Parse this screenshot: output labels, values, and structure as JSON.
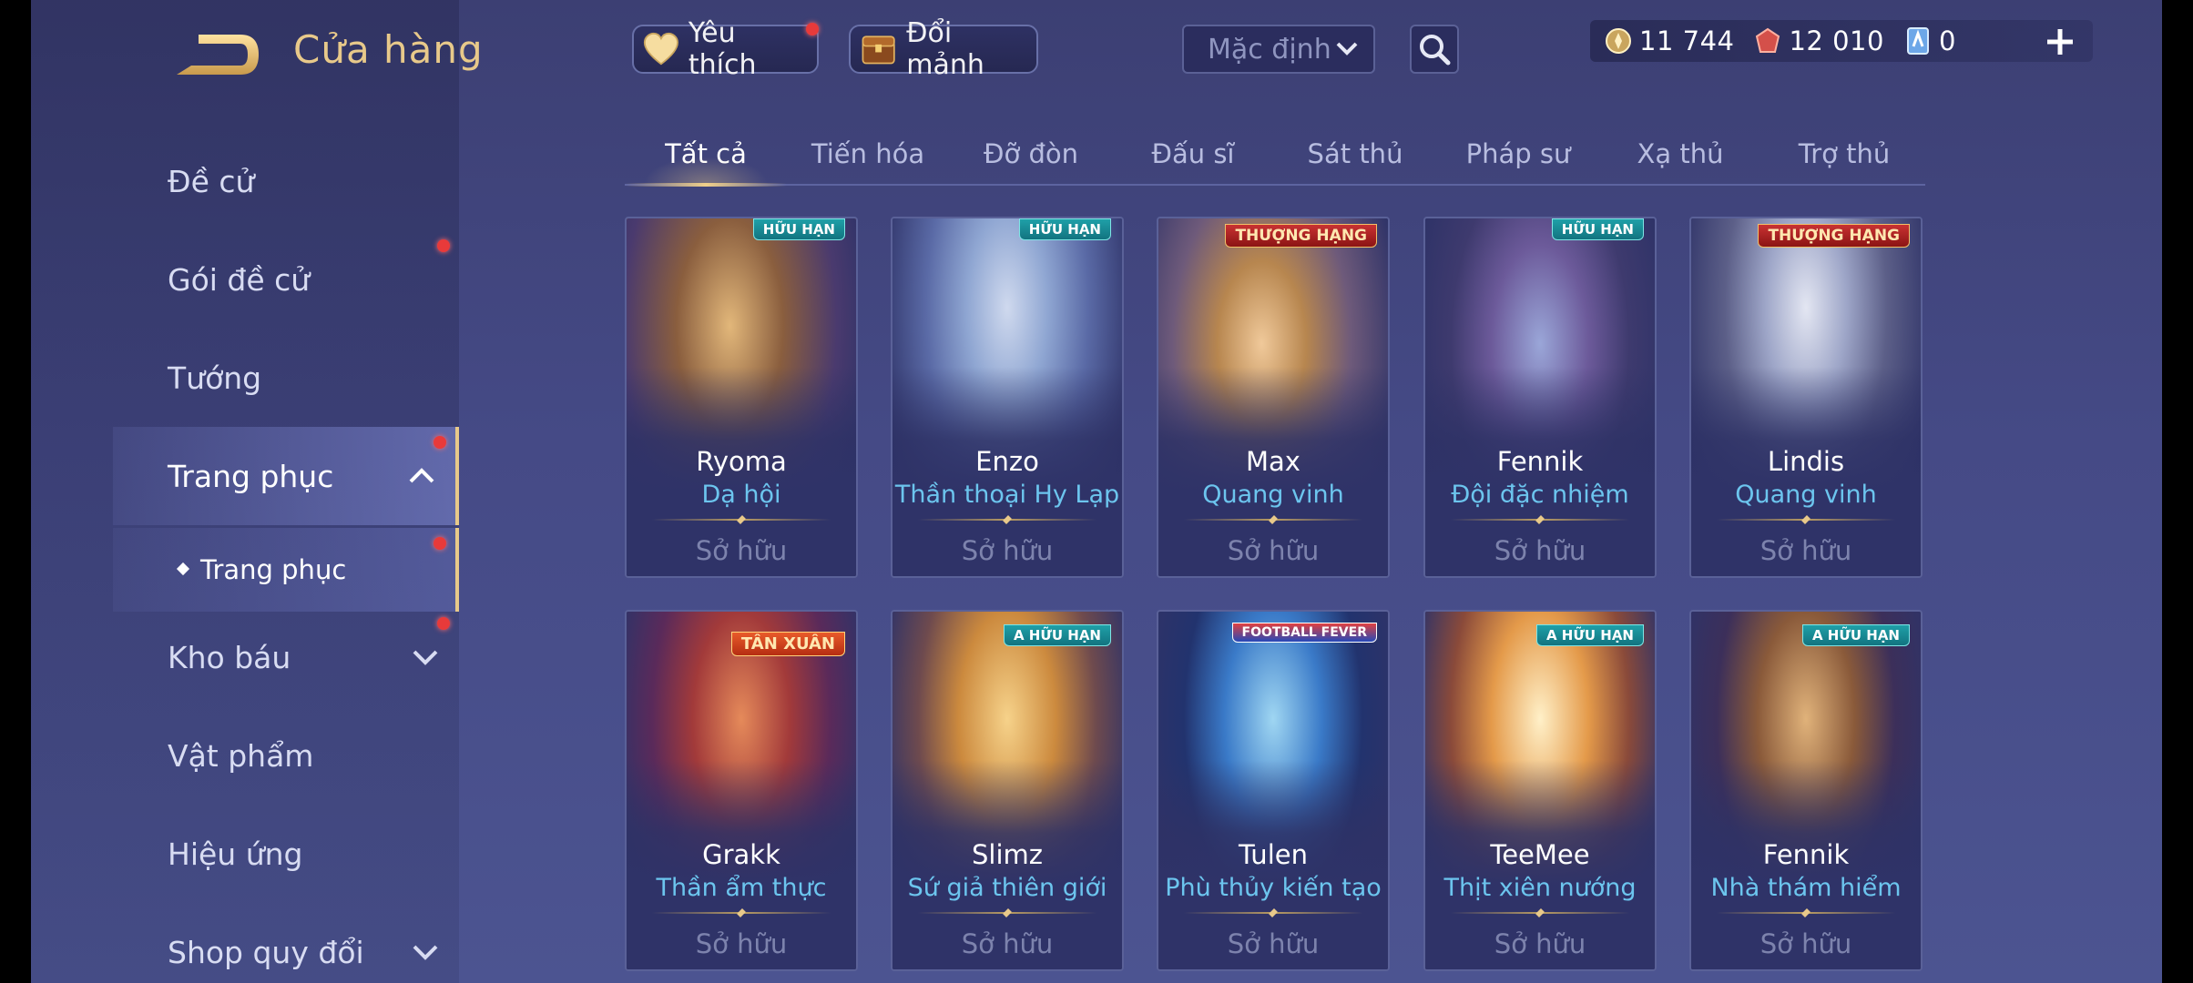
{
  "header": {
    "title": "Cửa hàng",
    "favorite_label": "Yêu thích",
    "trade_label": "Đổi mảnh",
    "sort_value": "Mặc định"
  },
  "currencies": [
    {
      "icon": "gold-coin-icon",
      "value": "11 744"
    },
    {
      "icon": "red-gem-icon",
      "value": "12 010"
    },
    {
      "icon": "blue-card-icon",
      "value": "0"
    }
  ],
  "sidebar": {
    "items": [
      {
        "label": "Đề cử"
      },
      {
        "label": "Gói đề cử"
      },
      {
        "label": "Tướng"
      },
      {
        "label": "Trang phục"
      },
      {
        "label": "Kho báu"
      },
      {
        "label": "Vật phẩm"
      },
      {
        "label": "Hiệu ứng"
      },
      {
        "label": "Shop quy đổi"
      }
    ],
    "sub_item": "Trang phục"
  },
  "tabs": [
    "Tất cả",
    "Tiến hóa",
    "Đỡ đòn",
    "Đấu sĩ",
    "Sát thủ",
    "Pháp sư",
    "Xạ thủ",
    "Trợ thủ"
  ],
  "active_tab": "Tất cả",
  "cards": [
    {
      "hero": "Ryoma",
      "skin": "Dạ hội",
      "status": "Sở hữu",
      "badge": "HỮU HẠN"
    },
    {
      "hero": "Enzo",
      "skin": "Thần thoại Hy Lạp",
      "status": "Sở hữu",
      "badge": "HỮU HẠN"
    },
    {
      "hero": "Max",
      "skin": "Quang vinh",
      "status": "Sở hữu",
      "badge": "THƯỢNG HẠNG"
    },
    {
      "hero": "Fennik",
      "skin": "Đội đặc nhiệm",
      "status": "Sở hữu",
      "badge": "HỮU HẠN"
    },
    {
      "hero": "Lindis",
      "skin": "Quang vinh",
      "status": "Sở hữu",
      "badge": "THƯỢNG HẠNG"
    },
    {
      "hero": "Grakk",
      "skin": "Thần ẩm thực",
      "status": "Sở hữu",
      "badge": "TÂN XUÂN"
    },
    {
      "hero": "Slimz",
      "skin": "Sứ giả thiên giới",
      "status": "Sở hữu",
      "badge": "A HỮU HẠN"
    },
    {
      "hero": "Tulen",
      "skin": "Phù thủy kiến tạo",
      "status": "Sở hữu",
      "badge": "FOOTBALL FEVER"
    },
    {
      "hero": "TeeMee",
      "skin": "Thịt xiên nướng",
      "status": "Sở hữu",
      "badge": "A HỮU HẠN"
    },
    {
      "hero": "Fennik",
      "skin": "Nhà thám hiểm",
      "status": "Sở hữu",
      "badge": "A HỮU HẠN"
    }
  ],
  "colors": {
    "accent_gold": "#e8c98a",
    "skin_name": "#6cc5ee",
    "notification_dot": "#e83a3a"
  }
}
